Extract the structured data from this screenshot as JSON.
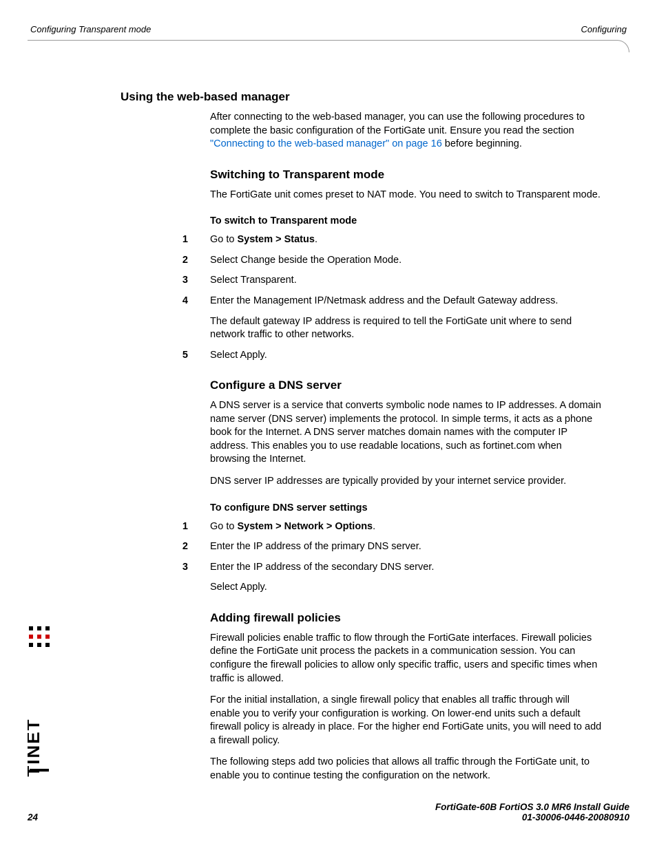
{
  "header": {
    "left": "Configuring Transparent mode",
    "right": "Configuring"
  },
  "sections": {
    "s1_title": "Using the web-based manager",
    "s1_p1a": "After connecting to the web-based manager, you can use the following procedures to complete the basic configuration of the FortiGate unit. Ensure you read the section ",
    "s1_link": "\"Connecting to the web-based manager\" on page 16",
    "s1_p1b": " before beginning.",
    "s2_title": "Switching to Transparent mode",
    "s2_p1": "The FortiGate unit comes preset to NAT mode. You need to switch to Transparent mode.",
    "s2_proc_title": "To switch to Transparent mode",
    "s2_step1a": "Go to ",
    "s2_step1b": "System > Status",
    "s2_step1c": ".",
    "s2_step2": "Select Change beside the Operation Mode.",
    "s2_step3": "Select Transparent.",
    "s2_step4": "Enter the Management IP/Netmask address and the Default Gateway address.",
    "s2_step4_note": "The default gateway IP address is required to tell the FortiGate unit where to send network traffic to other networks.",
    "s2_step5": "Select Apply.",
    "s3_title": "Configure a DNS server",
    "s3_p1": "A DNS server is a service that converts symbolic node names to IP addresses. A domain name server (DNS server) implements the protocol. In simple terms, it acts as a phone book for the Internet. A DNS server matches domain names with the computer IP address. This enables you to use readable locations, such as fortinet.com when browsing the Internet.",
    "s3_p2": "DNS server IP addresses are typically provided by your internet service provider.",
    "s3_proc_title": "To configure DNS server settings",
    "s3_step1a": "Go to ",
    "s3_step1b": "System > Network > Options",
    "s3_step1c": ".",
    "s3_step2": "Enter the IP address of the primary DNS server.",
    "s3_step3": "Enter the IP address of the secondary DNS server.",
    "s3_step3_note": "Select Apply.",
    "s4_title": "Adding firewall policies",
    "s4_p1": "Firewall policies enable traffic to flow through the FortiGate interfaces. Firewall policies define the FortiGate unit process the packets in a communication session. You can configure the firewall policies to allow only specific traffic, users and specific times when traffic is allowed.",
    "s4_p2": "For the initial installation, a single firewall policy that enables all traffic through will enable you to verify your configuration is working. On lower-end units such a default firewall policy is already in place. For the higher end FortiGate units, you will need to add a firewall policy.",
    "s4_p3": "The following steps add two policies that allows all traffic through the FortiGate unit, to enable you to continue testing the configuration on the network."
  },
  "nums": {
    "n1": "1",
    "n2": "2",
    "n3": "3",
    "n4": "4",
    "n5": "5"
  },
  "footer": {
    "page": "24",
    "line1": "FortiGate-60B FortiOS 3.0 MR6 Install Guide",
    "line2": "01-30006-0446-20080910"
  }
}
